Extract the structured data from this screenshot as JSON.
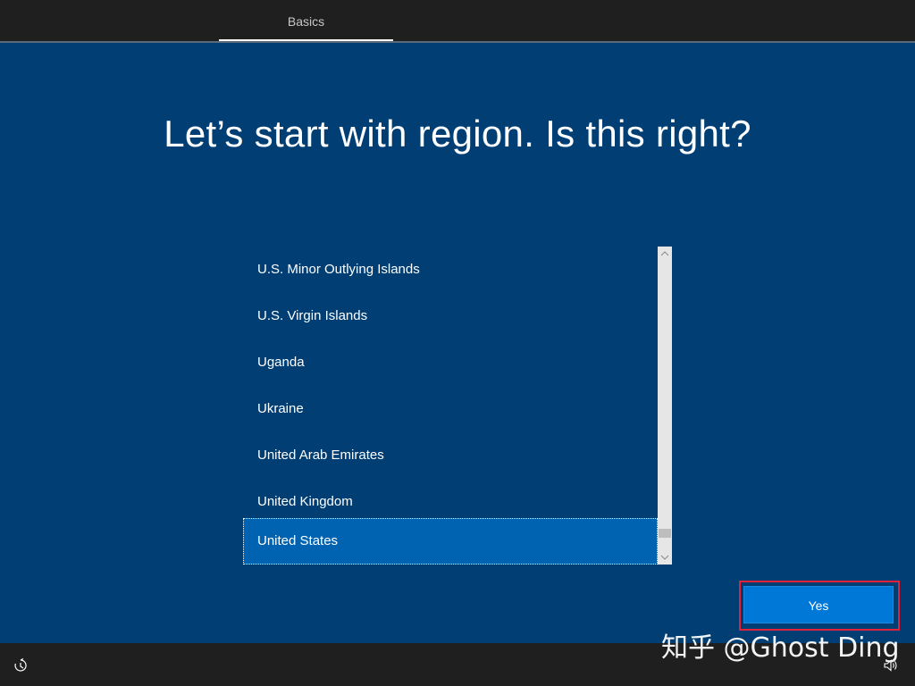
{
  "header": {
    "tab_label": "Basics"
  },
  "main": {
    "title": "Let’s start with region. Is this right?"
  },
  "region_list": {
    "items": [
      {
        "label": "U.S. Minor Outlying Islands",
        "selected": false
      },
      {
        "label": "U.S. Virgin Islands",
        "selected": false
      },
      {
        "label": "Uganda",
        "selected": false
      },
      {
        "label": "Ukraine",
        "selected": false
      },
      {
        "label": "United Arab Emirates",
        "selected": false
      },
      {
        "label": "United Kingdom",
        "selected": false
      },
      {
        "label": "United States",
        "selected": true
      }
    ],
    "scroll_up_icon": "chevron-up-icon",
    "scroll_down_icon": "chevron-down-icon"
  },
  "actions": {
    "yes_label": "Yes"
  },
  "footer": {
    "ease_of_access_icon": "ease-of-access-icon",
    "volume_icon": "volume-icon"
  },
  "watermark": {
    "text": "知乎 @Ghost Ding"
  },
  "colors": {
    "background": "#003e74",
    "selected_item": "#0063b1",
    "button": "#0078d7",
    "highlight_border": "#e0233b",
    "bars": "#1f1f1f"
  }
}
